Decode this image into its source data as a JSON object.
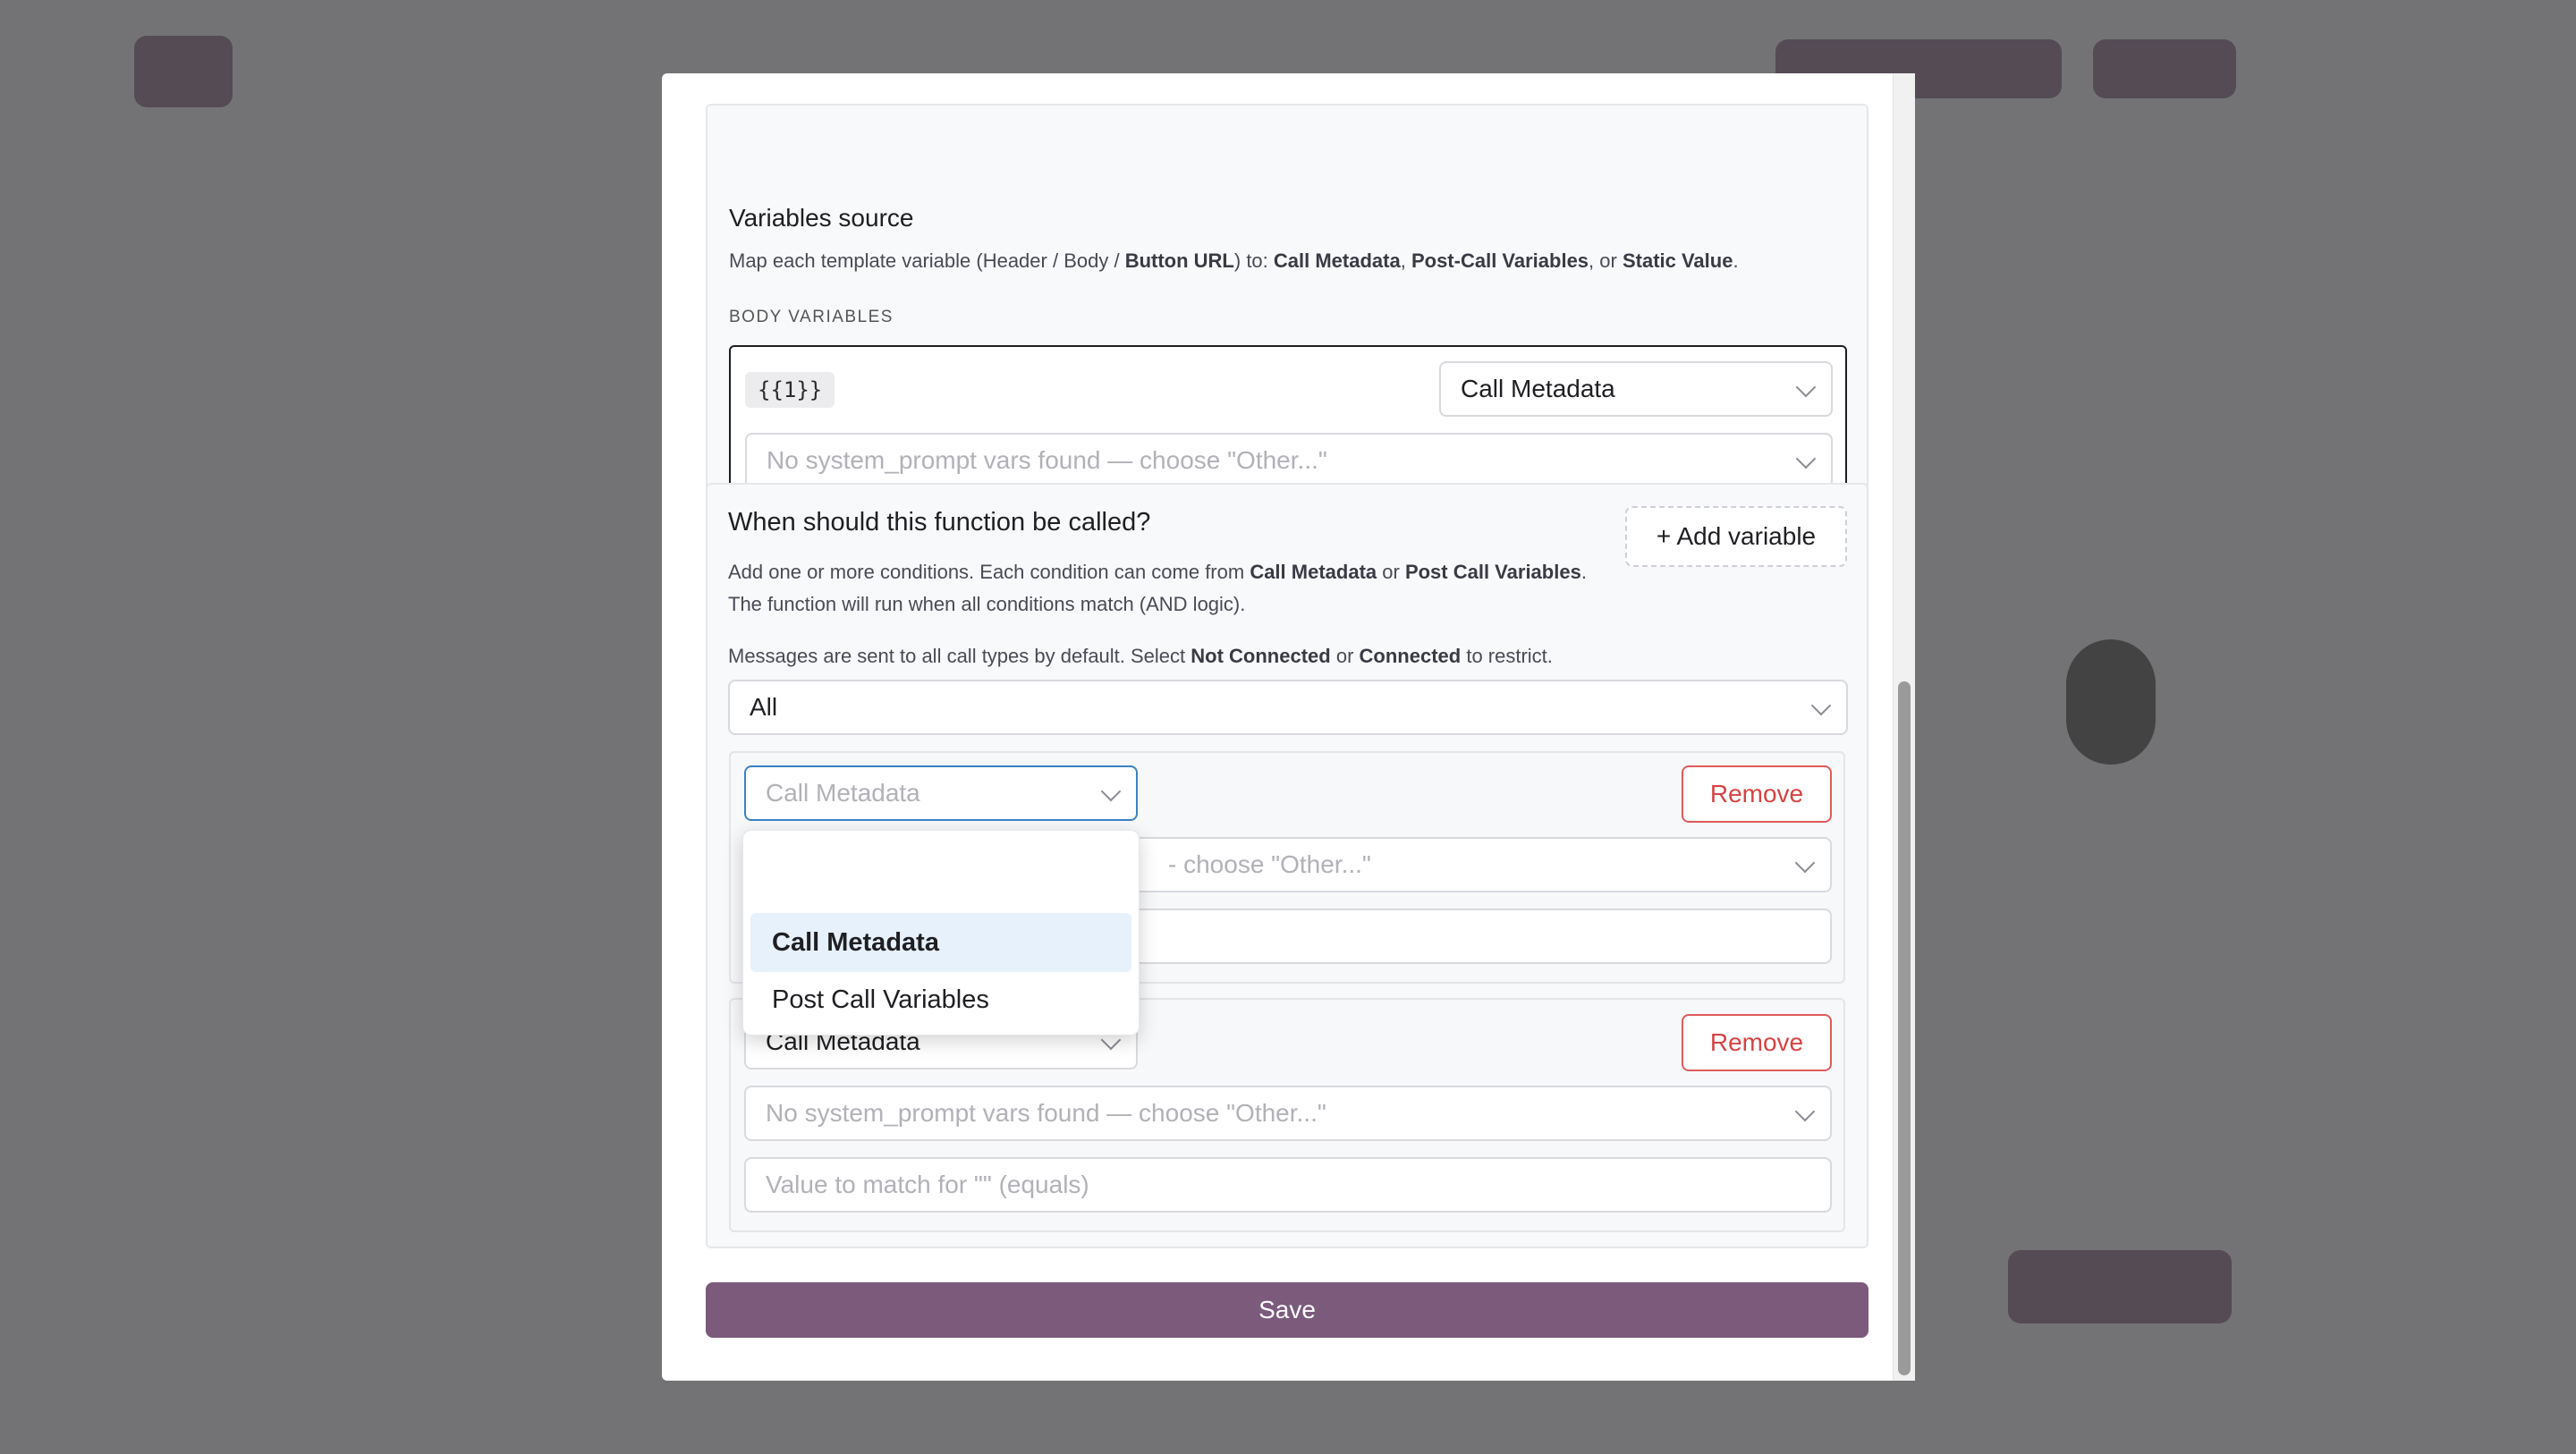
{
  "variables_source": {
    "title": "Variables source",
    "desc_prefix": "Map each template variable (Header / Body / ",
    "desc_button_url": "Button URL",
    "desc_to": ") to: ",
    "desc_call_metadata": "Call Metadata",
    "desc_comma": ", ",
    "desc_post_call": "Post-Call Variables",
    "desc_or": ", or ",
    "desc_static": "Static Value",
    "desc_end": ".",
    "body_caption": "BODY VARIABLES",
    "var_chip": "{{1}}",
    "source_select": "Call Metadata",
    "var_select_placeholder": "No system_prompt vars found — choose \"Other...\""
  },
  "conditions": {
    "title": "When should this function be called?",
    "add_button": "+ Add variable",
    "desc1_a": "Add one or more conditions. Each condition can come from ",
    "desc1_b": "Call Metadata",
    "desc1_c": " or ",
    "desc1_d": "Post Call Variables",
    "desc1_e": ". The function will run when all conditions match (AND logic).",
    "desc2_a": "Messages are sent to all call types by default. Select ",
    "desc2_b": "Not Connected",
    "desc2_c": " or ",
    "desc2_d": "Connected",
    "desc2_e": " to restrict.",
    "call_type_select": "All",
    "cond1": {
      "source_placeholder": "Call Metadata",
      "var_placeholder_visible": "- choose \"Other...\"",
      "remove": "Remove"
    },
    "cond2": {
      "source_select": "Call Metadata",
      "var_select_placeholder": "No system_prompt vars found — choose \"Other...\"",
      "value_placeholder": "Value to match for \"\" (equals)",
      "remove": "Remove"
    },
    "dropdown_options": [
      "Call Metadata",
      "Post Call Variables"
    ]
  },
  "save_button": "Save",
  "colors": {
    "accent": "#7c5a7c",
    "danger": "#d64343",
    "focus": "#3b82c4",
    "highlight": "#e7f1fb"
  }
}
